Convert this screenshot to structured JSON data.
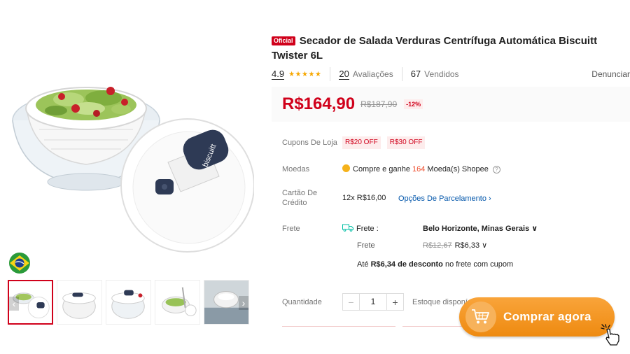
{
  "product": {
    "badge": "Oficial",
    "title": "Secador de Salada Verduras Centrífuga Automática Biscuitt Twister 6L",
    "rating": "4.9",
    "stars": "★★★★★",
    "reviews_count": "20",
    "reviews_label": "Avaliações",
    "sold_count": "67",
    "sold_label": "Vendidos",
    "report_label": "Denunciar"
  },
  "price": {
    "current": "R$164,90",
    "old": "R$187,90",
    "discount": "-12%"
  },
  "coupons": {
    "label": "Cupons De Loja",
    "items": [
      "R$20 OFF",
      "R$30 OFF"
    ]
  },
  "coins": {
    "label": "Moedas",
    "text_before": "Compre e ganhe ",
    "amount": "164",
    "text_after": " Moeda(s) Shopee"
  },
  "card": {
    "label": "Cartão De Crédito",
    "installments": "12x R$16,00",
    "options_link": "Opções De Parcelamento ›"
  },
  "shipping": {
    "label": "Frete",
    "to_label": "Frete :",
    "destination": "Belo Horizonte, Minas Gerais ∨",
    "cost_label": "Frete",
    "cost_old": "R$12,67",
    "cost_new": "R$6,33 ∨",
    "discount_prefix": "Até ",
    "discount_amount": "R$6,34 de desconto",
    "discount_suffix": " no frete com cupom"
  },
  "quantity": {
    "label": "Quantidade",
    "minus": "−",
    "value": "1",
    "plus": "+",
    "stock_label": "Estoque disponí"
  },
  "buy_button": {
    "label": "Comprar agora"
  },
  "gallery": {
    "lid_brand": "biscuitt",
    "prev_arrow": "‹",
    "next_arrow": "›"
  },
  "colors": {
    "brand_red": "#d0011b",
    "accent_orange": "#ee8a10",
    "link_blue": "#0055aa"
  },
  "icons": [
    "brazil-flag-icon",
    "truck-icon",
    "coin-icon",
    "help-icon",
    "cart-icon",
    "click-cursor-icon",
    "chevron-right-icon",
    "chevron-left-icon"
  ]
}
